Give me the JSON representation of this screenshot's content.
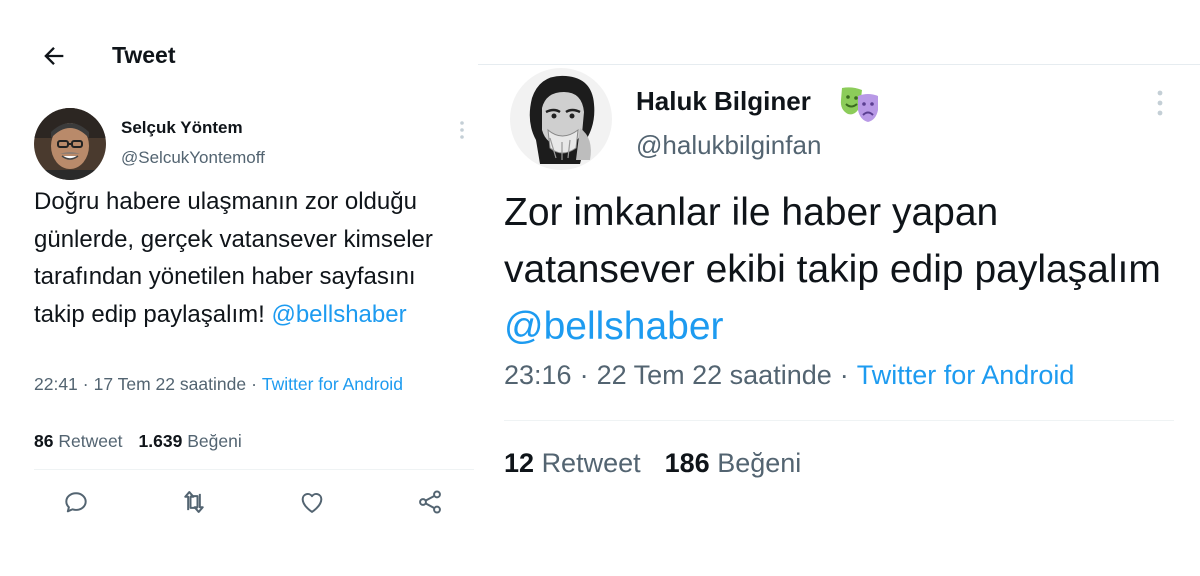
{
  "header": {
    "title": "Tweet"
  },
  "left_tweet": {
    "author_name": "Selçuk Yöntem",
    "author_handle": "@SelcukYontemoff",
    "text": "Doğru habere ulaşmanın zor olduğu günlerde, gerçek vatansever kimseler tarafından yönetilen haber sayfasını takip edip paylaşalım! ",
    "mention": "@bellshaber",
    "time": "22:41",
    "date": "17 Tem 22 saatinde",
    "source": "Twitter for Android",
    "retweet_count": "86",
    "retweet_label": "Retweet",
    "like_count": "1.639",
    "like_label": "Beğeni"
  },
  "right_tweet": {
    "author_name": "Haluk Bilginer",
    "author_handle": "@halukbilginfan",
    "text": "Zor imkanlar ile haber yapan vatansever ekibi takip edip paylaşalım ",
    "mention": "@bellshaber",
    "time": "23:16",
    "date": "22 Tem 22 saatinde",
    "source": "Twitter for Android",
    "retweet_count": "12",
    "retweet_label": "Retweet",
    "like_count": "186",
    "like_label": "Beğeni"
  },
  "icons": {
    "back": "arrow-left-icon",
    "more": "more-vertical-icon",
    "reply": "reply-icon",
    "retweet": "retweet-icon",
    "like": "heart-icon",
    "share": "share-icon",
    "name_emoji": "performing-arts-icon"
  },
  "colors": {
    "link": "#1d9bf0",
    "muted": "#536471",
    "text": "#0f1419"
  }
}
